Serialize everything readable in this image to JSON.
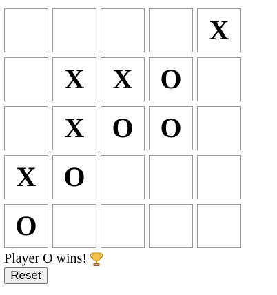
{
  "game": {
    "board": [
      [
        "",
        "",
        "",
        "",
        "X"
      ],
      [
        "",
        "X",
        "X",
        "O",
        ""
      ],
      [
        "",
        "X",
        "O",
        "O",
        ""
      ],
      [
        "X",
        "O",
        "",
        "",
        ""
      ],
      [
        "O",
        "",
        "",
        "",
        ""
      ]
    ],
    "status_text": "Player O wins!",
    "status_icon": "trophy-icon",
    "reset_label": "Reset"
  }
}
